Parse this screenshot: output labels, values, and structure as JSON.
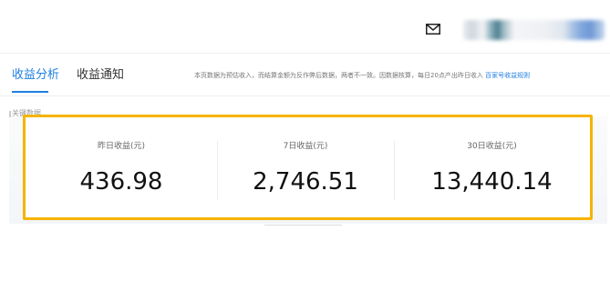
{
  "header": {
    "mail_icon": "mail-icon",
    "user_info_blurred": true
  },
  "tabs": [
    {
      "label": "收益分析",
      "active": true
    },
    {
      "label": "收益通知",
      "active": false
    }
  ],
  "notice": {
    "text": "本页数据为预估收入，而结算金额为反作弊后数据，两者不一致。因数据核算，每日20点产出昨日收入",
    "link_label": "百家号收益规则"
  },
  "section": {
    "title": "关键数据"
  },
  "stats": [
    {
      "label": "昨日收益(元)",
      "value": "436.98"
    },
    {
      "label": "7日收益(元)",
      "value": "2,746.51"
    },
    {
      "label": "30日收益(元)",
      "value": "13,440.14"
    }
  ],
  "colors": {
    "accent": "#1f7fe0",
    "highlight_border": "#f5b400",
    "value_text": "#111111"
  }
}
